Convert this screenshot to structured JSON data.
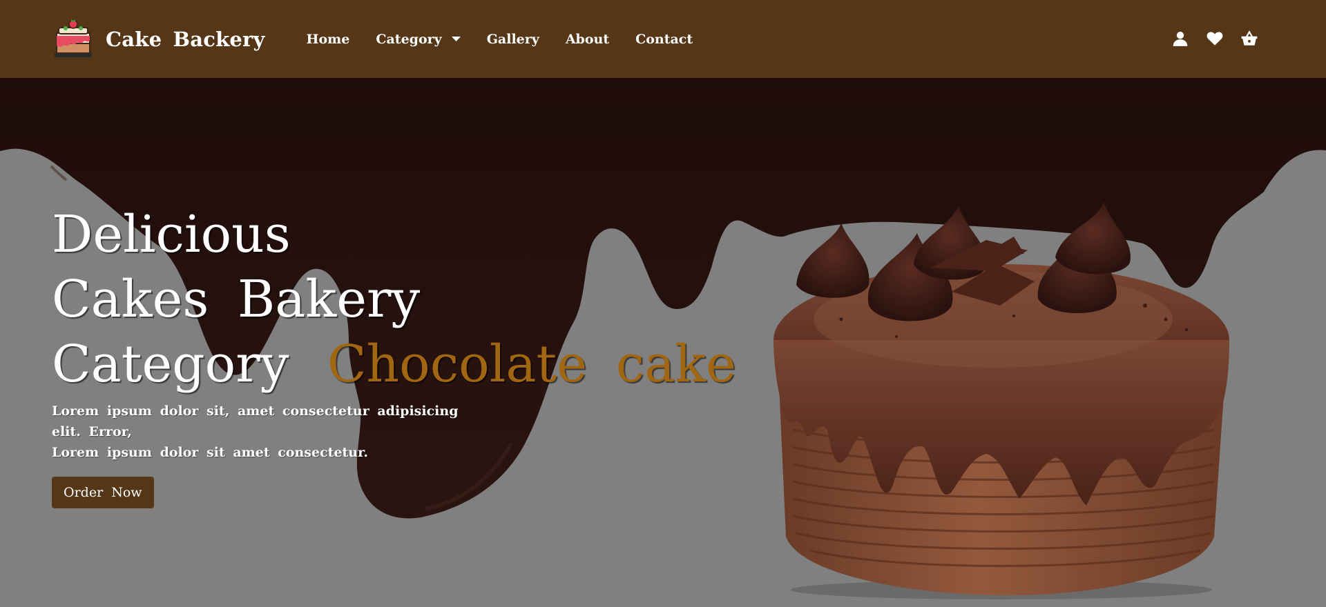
{
  "navbar": {
    "brand_name": "Cake  Backery",
    "logo_icon": "cake-logo-icon",
    "links": [
      {
        "label": "Home"
      },
      {
        "label": "Category",
        "icon": "caret-down-icon"
      },
      {
        "label": "Gallery"
      },
      {
        "label": "About"
      },
      {
        "label": "Contact"
      }
    ],
    "icons": [
      "user-icon",
      "heart-icon",
      "basket-icon"
    ]
  },
  "hero": {
    "line1": "Delicious",
    "line2": "Cakes  Bakery",
    "line3_main": "Category",
    "line3_accent": "Chocolate  cake",
    "lead_line1": "Lorem  ipsum  dolor  sit,  amet  consectetur  adipisicing  elit.  Error,",
    "lead_line2": "Lorem  ipsum  dolor  sit  amet  consectetur.",
    "cta_label": "Order  Now",
    "image": "chocolate-cake-image",
    "backdrop": "chocolate-drip"
  },
  "colors": {
    "navbar_bg": "#553718",
    "hero_bg": "#808080",
    "drip": "#1f0d0b",
    "accent_text": "#a16611",
    "button_bg": "#553718"
  }
}
